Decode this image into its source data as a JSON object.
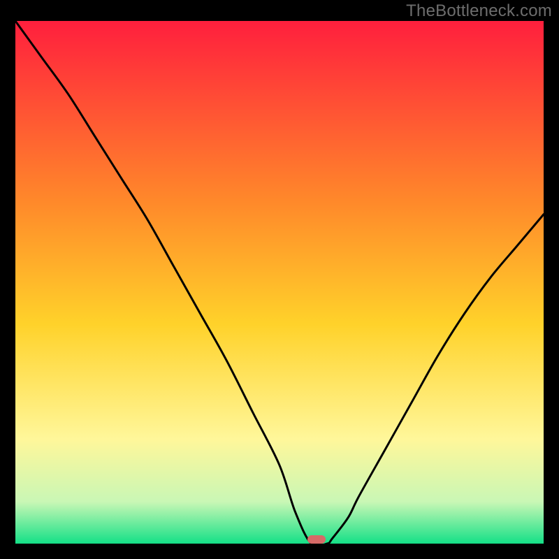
{
  "watermark": "TheBottleneck.com",
  "colors": {
    "gradient_top": "#ff1f3d",
    "gradient_mid1": "#ff7a2c",
    "gradient_mid2": "#ffd22a",
    "gradient_mid3": "#fff79a",
    "gradient_bottom1": "#baf7b0",
    "gradient_bottom2": "#14e087",
    "curve_stroke": "#000000",
    "marker_fill": "#d66a67"
  },
  "chart_data": {
    "type": "line",
    "title": "",
    "xlabel": "",
    "ylabel": "",
    "xlim": [
      0,
      100
    ],
    "ylim": [
      0,
      100
    ],
    "series": [
      {
        "name": "bottleneck-curve",
        "x": [
          0,
          5,
          10,
          15,
          20,
          25,
          30,
          35,
          40,
          45,
          50,
          53,
          56,
          59,
          60,
          63,
          65,
          70,
          75,
          80,
          85,
          90,
          95,
          100
        ],
        "values": [
          100,
          93,
          86,
          78,
          70,
          62,
          53,
          44,
          35,
          25,
          15,
          6,
          0,
          0,
          1,
          5,
          9,
          18,
          27,
          36,
          44,
          51,
          57,
          63
        ]
      }
    ],
    "marker": {
      "x": 57,
      "y": 0.8
    },
    "background_gradient_stops": [
      {
        "offset": 0.0,
        "color": "#ff1f3d"
      },
      {
        "offset": 0.35,
        "color": "#ff8a2a"
      },
      {
        "offset": 0.58,
        "color": "#ffd22a"
      },
      {
        "offset": 0.8,
        "color": "#fff79a"
      },
      {
        "offset": 0.92,
        "color": "#c9f7b5"
      },
      {
        "offset": 1.0,
        "color": "#14e087"
      }
    ]
  }
}
